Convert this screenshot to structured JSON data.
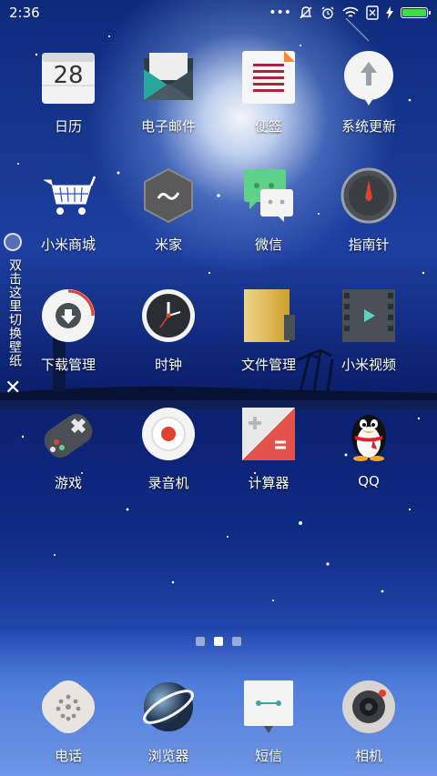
{
  "status_bar": {
    "time": "2:36",
    "icons": [
      "more-dots-icon",
      "mute-bell-icon",
      "alarm-icon",
      "wifi-icon",
      "no-sim-icon",
      "charging-icon",
      "battery-icon"
    ],
    "battery_level": 1.0
  },
  "apps": {
    "row1": [
      {
        "label": "日历",
        "icon": "calendar-icon",
        "date": "28"
      },
      {
        "label": "电子邮件",
        "icon": "mail-icon"
      },
      {
        "label": "便签",
        "icon": "notes-icon"
      },
      {
        "label": "系统更新",
        "icon": "system-update-icon"
      }
    ],
    "row2": [
      {
        "label": "小米商城",
        "icon": "shopping-cart-icon"
      },
      {
        "label": "米家",
        "icon": "mijia-icon"
      },
      {
        "label": "微信",
        "icon": "wechat-icon"
      },
      {
        "label": "指南针",
        "icon": "compass-icon"
      }
    ],
    "row3": [
      {
        "label": "下载管理",
        "icon": "download-icon"
      },
      {
        "label": "时钟",
        "icon": "clock-icon"
      },
      {
        "label": "文件管理",
        "icon": "file-manager-icon"
      },
      {
        "label": "小米视频",
        "icon": "video-icon"
      }
    ],
    "row4": [
      {
        "label": "游戏",
        "icon": "gamepad-icon"
      },
      {
        "label": "录音机",
        "icon": "recorder-icon"
      },
      {
        "label": "计算器",
        "icon": "calculator-icon"
      },
      {
        "label": "QQ",
        "icon": "qq-penguin-icon"
      }
    ]
  },
  "dock": [
    {
      "label": "电话",
      "icon": "phone-icon"
    },
    {
      "label": "浏览器",
      "icon": "browser-icon"
    },
    {
      "label": "短信",
      "icon": "sms-icon"
    },
    {
      "label": "相机",
      "icon": "camera-icon"
    }
  ],
  "side_overlay": {
    "text": "双击这里切换壁纸",
    "close": "✕"
  },
  "pager": {
    "count": 3,
    "active": 1
  },
  "colors": {
    "battery": "#3fdc4a",
    "wallpaper_top": "#0e2a7a",
    "wallpaper_bottom": "#2a4fb6"
  }
}
